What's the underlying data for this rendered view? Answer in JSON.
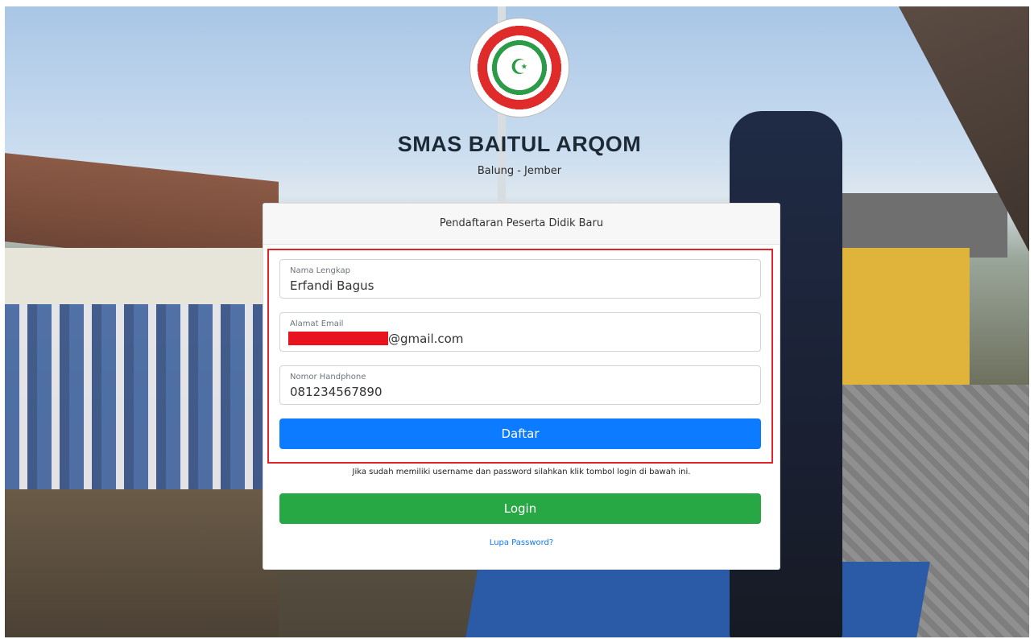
{
  "school": {
    "name": "SMAS BAITUL ARQOM",
    "location": "Balung - Jember",
    "logo_icon": "school-emblem-icon"
  },
  "form": {
    "title": "Pendaftaran Peserta Didik Baru",
    "fields": [
      {
        "label": "Nama Lengkap",
        "value": "Erfandi Bagus"
      },
      {
        "label": "Alamat Email",
        "value": "@gmail.com"
      },
      {
        "label": "Nomor Handphone",
        "value": "081234567890"
      }
    ],
    "submit_label": "Daftar",
    "login_info": "Jika sudah memiliki username dan password silahkan klik tombol login di bawah ini.",
    "login_label": "Login",
    "forgot_label": "Lupa Password?"
  },
  "colors": {
    "primary": "#0d7bff",
    "success": "#28a745",
    "highlight": "#e0242b",
    "redaction": "#e8131f"
  }
}
